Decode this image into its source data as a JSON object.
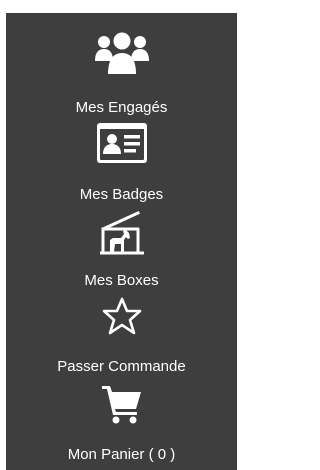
{
  "colors": {
    "sidebar_background": "#3e3e3e",
    "text": "#ffffff",
    "icon": "#ffffff"
  },
  "menu": {
    "items": [
      {
        "label": "Mes Engagés",
        "icon": "users-group-icon"
      },
      {
        "label": "Mes Badges",
        "icon": "id-badge-icon"
      },
      {
        "label": "Mes Boxes",
        "icon": "horse-stable-icon"
      },
      {
        "label": "Passer Commande",
        "icon": "star-outline-icon"
      },
      {
        "label": "Mon Panier ( 0 )",
        "icon": "shopping-cart-icon"
      }
    ]
  }
}
